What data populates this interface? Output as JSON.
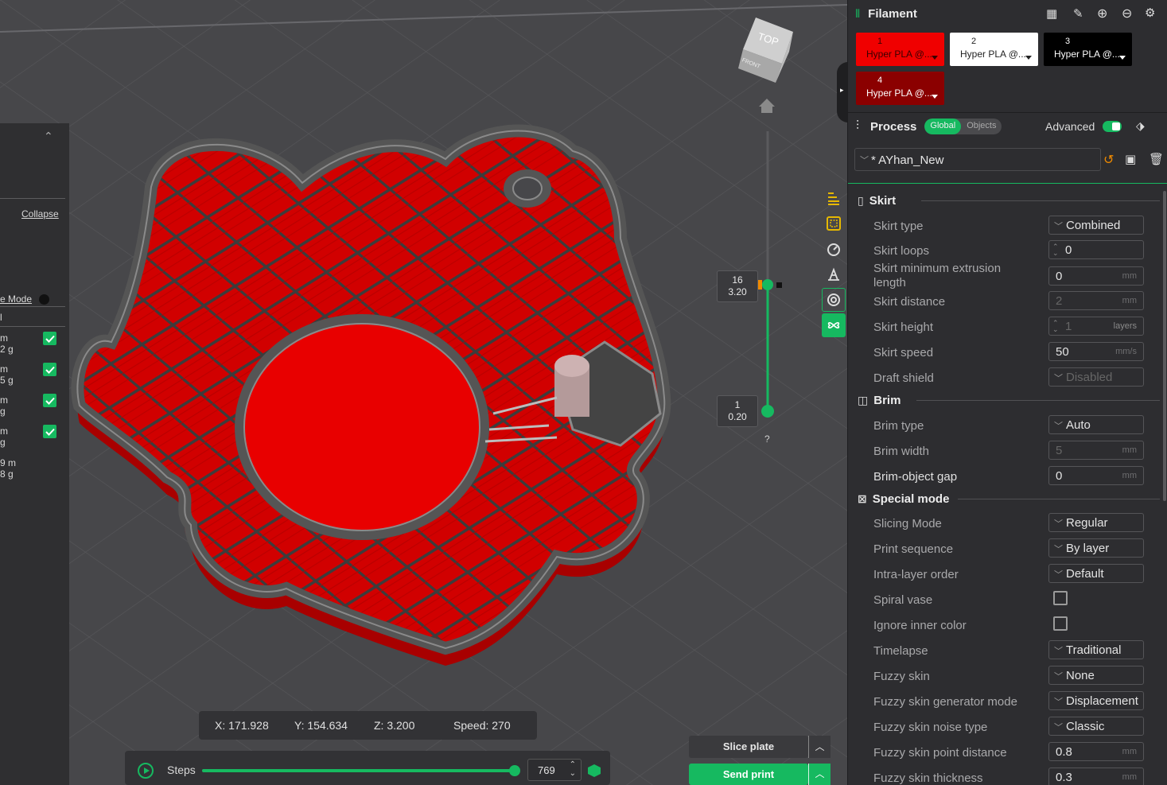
{
  "left_panel": {
    "collapse_label": "Collapse",
    "mode_label": "e Mode",
    "item_l": "l",
    "items": [
      {
        "line1": "m",
        "line2": "2 g"
      },
      {
        "line1": "m",
        "line2": "5 g"
      },
      {
        "line1": "m",
        "line2": "g"
      },
      {
        "line1": "m",
        "line2": "g"
      }
    ],
    "total_line1": "9 m",
    "total_line2": "8 g"
  },
  "viewport": {
    "layer_top": {
      "number": "16",
      "height": "3.20"
    },
    "layer_bottom": {
      "number": "1",
      "height": "0.20"
    },
    "help": "?",
    "nav_cube": {
      "top_label": "TOP",
      "front_label": "FRONT"
    },
    "coords": {
      "x": "X: 171.928",
      "y": "Y: 154.634",
      "z": "Z: 3.200",
      "speed": "Speed: 270"
    },
    "steps": {
      "label": "Steps",
      "value": "769",
      "progress": 1.0
    },
    "slice_plate_label": "Slice plate",
    "send_print_label": "Send print"
  },
  "filament": {
    "title": "Filament",
    "chips": [
      {
        "num": "1",
        "name": "Hyper PLA @...",
        "bg": "#f00000",
        "fg": "#3a0000"
      },
      {
        "num": "2",
        "name": "Hyper PLA @...",
        "bg": "#ffffff",
        "fg": "#222222"
      },
      {
        "num": "3",
        "name": "Hyper PLA @...",
        "bg": "#000000",
        "fg": "#ffffff"
      },
      {
        "num": "4",
        "name": "Hyper PLA @...",
        "bg": "#8b0000",
        "fg": "#ffffff"
      }
    ]
  },
  "process": {
    "title": "Process",
    "tab_global": "Global",
    "tab_objects": "Objects",
    "advanced_label": "Advanced",
    "preset_name": "* AYhan_New"
  },
  "sections": {
    "skirt": "Skirt",
    "brim": "Brim",
    "special": "Special mode"
  },
  "settings": {
    "skirt_type": {
      "label": "Skirt type",
      "value": "Combined"
    },
    "skirt_loops": {
      "label": "Skirt loops",
      "value": "0"
    },
    "skirt_min_ext_1": {
      "label": "Skirt minimum extrusion"
    },
    "skirt_min_ext_2": {
      "label": "length",
      "value": "0",
      "unit": "mm"
    },
    "skirt_distance": {
      "label": "Skirt distance",
      "value": "2",
      "unit": "mm"
    },
    "skirt_height": {
      "label": "Skirt height",
      "value": "1",
      "unit": "layers"
    },
    "skirt_speed": {
      "label": "Skirt speed",
      "value": "50",
      "unit": "mm/s"
    },
    "draft_shield": {
      "label": "Draft shield",
      "value": "Disabled"
    },
    "brim_type": {
      "label": "Brim type",
      "value": "Auto"
    },
    "brim_width": {
      "label": "Brim width",
      "value": "5",
      "unit": "mm"
    },
    "brim_gap": {
      "label": "Brim-object gap",
      "value": "0",
      "unit": "mm"
    },
    "slicing_mode": {
      "label": "Slicing Mode",
      "value": "Regular"
    },
    "print_sequence": {
      "label": "Print sequence",
      "value": "By layer"
    },
    "intra_layer": {
      "label": "Intra-layer order",
      "value": "Default"
    },
    "spiral_vase": {
      "label": "Spiral vase"
    },
    "ignore_inner": {
      "label": "Ignore inner color"
    },
    "timelapse": {
      "label": "Timelapse",
      "value": "Traditional"
    },
    "fuzzy_skin": {
      "label": "Fuzzy skin",
      "value": "None"
    },
    "fuzzy_gen": {
      "label": "Fuzzy skin generator mode",
      "value": "Displacement"
    },
    "fuzzy_noise": {
      "label": "Fuzzy skin noise type",
      "value": "Classic"
    },
    "fuzzy_point": {
      "label": "Fuzzy skin point distance",
      "value": "0.8",
      "unit": "mm"
    },
    "fuzzy_thick": {
      "label": "Fuzzy skin thickness",
      "value": "0.3",
      "unit": "mm"
    }
  },
  "colors": {
    "accent": "#16b960",
    "print_red": "#e00000"
  }
}
